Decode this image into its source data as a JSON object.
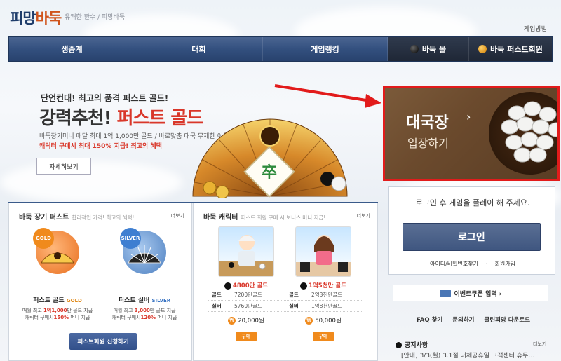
{
  "header": {
    "logo_part1": "피망",
    "logo_part2": "바둑",
    "tagline": "유쾌한 한수 / 피망바둑",
    "game_guide": "게임방법"
  },
  "nav": {
    "items": [
      "생중계",
      "대회",
      "게임랭킹",
      "바둑 몰",
      "바둑 퍼스트회원"
    ]
  },
  "hero": {
    "subtitle": "단언컨대! 최고의 품격 퍼스트 골드!",
    "title_black": "강력추천!",
    "title_red": "퍼스트 골드",
    "desc1": "바둑장기머니 매달 최대 1억 1,000만 골드 / 바로맞춤 대국 무제한 이용",
    "desc2": "캐릭터 구매시 최대 150% 지급! 최고의 혜택",
    "detail_button": "자세히보기"
  },
  "enter": {
    "line1": "대국장",
    "line2": "입장하기",
    "chevron": "›"
  },
  "login": {
    "message": "로그인 후 게임을 플레이 해 주세요.",
    "button": "로그인",
    "link_find": "아이디/비밀번호찾기",
    "link_join": "회원가입",
    "coupon": "이벤트쿠폰 입력 ›"
  },
  "quick_links": [
    "FAQ 찾기",
    "문의하기",
    "클린피망 다운로드"
  ],
  "notice": {
    "title": "공지사항",
    "more": "더보기",
    "line": "[안내] 3/3(월) 3.1절 대체공휴일 고객센터 휴무…"
  },
  "first_pass": {
    "title": "바둑 장기 퍼스트",
    "subtitle": "합리적인 가격! 최고의 혜택!",
    "more": "더보기",
    "gold": {
      "badge": "GOLD",
      "name": "퍼스트 골드",
      "name_en": "GOLD",
      "desc_a": "매월 최고 ",
      "desc_a_red": "1억1,000",
      "desc_a2": "만 골드 지급",
      "desc_b": "캐릭터 구매시",
      "desc_b_red": "150%",
      "desc_b2": " 머니 지급"
    },
    "silver": {
      "badge": "SILVER",
      "name": "퍼스트 실버",
      "name_en": "SILVER",
      "desc_a": "매월 최고 ",
      "desc_a_red": "3,000",
      "desc_a2": "만 골드 지급",
      "desc_b": "캐릭터 구매시",
      "desc_b_red": "120%",
      "desc_b2": " 머니 지급"
    },
    "apply_button": "퍼스트회원 신청하기"
  },
  "characters": {
    "title": "바둑 캐릭터",
    "subtitle": "퍼스트 회원 구매 시 보너스 머니 지급!",
    "more": "더보기",
    "items": [
      {
        "price_label": "4800만 골드",
        "gold_k": "골드",
        "gold_v": "7200만골드",
        "silver_k": "실버",
        "silver_v": "5760만골드",
        "won": "20,000원",
        "buy": "구매"
      },
      {
        "price_label": "1억5천만 골드",
        "gold_k": "골드",
        "gold_v": "2억3천만골드",
        "silver_k": "실버",
        "silver_v": "1억8천만골드",
        "won": "50,000원",
        "buy": "구매"
      }
    ]
  }
}
